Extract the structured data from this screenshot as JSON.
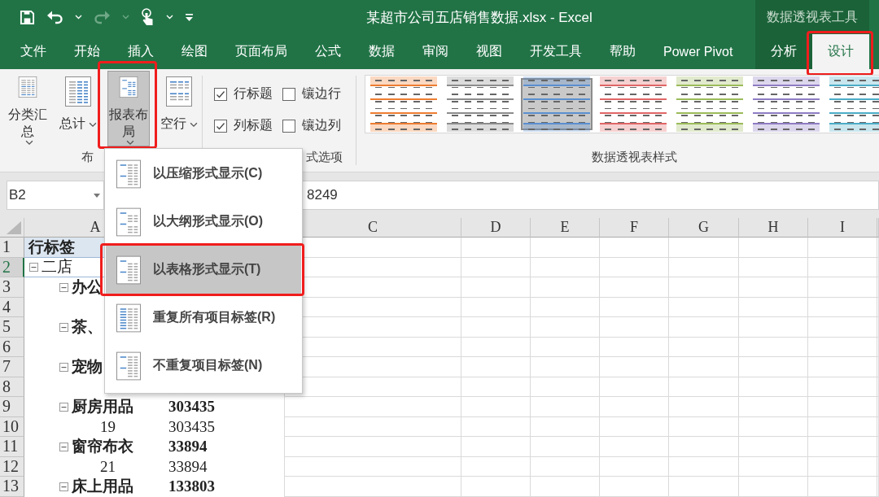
{
  "window": {
    "title": "某超市公司五店销售数据.xlsx  -  Excel",
    "context_label": "数据透视表工具"
  },
  "quick_access_toolbar": [
    {
      "kind": "save",
      "disabled": false
    },
    {
      "kind": "undo",
      "disabled": false
    },
    {
      "kind": "caret",
      "disabled": false
    },
    {
      "kind": "redo",
      "disabled": true
    },
    {
      "kind": "caret",
      "disabled": true
    },
    {
      "kind": "touch",
      "disabled": false
    },
    {
      "kind": "caret",
      "disabled": false
    },
    {
      "kind": "customize",
      "disabled": false
    }
  ],
  "tabs": [
    {
      "label": "文件",
      "selected": false,
      "contextual": false,
      "highlighted": false
    },
    {
      "label": "开始",
      "selected": false,
      "contextual": false,
      "highlighted": false
    },
    {
      "label": "插入",
      "selected": false,
      "contextual": false,
      "highlighted": false
    },
    {
      "label": "绘图",
      "selected": false,
      "contextual": false,
      "highlighted": false
    },
    {
      "label": "页面布局",
      "selected": false,
      "contextual": false,
      "highlighted": false
    },
    {
      "label": "公式",
      "selected": false,
      "contextual": false,
      "highlighted": false
    },
    {
      "label": "数据",
      "selected": false,
      "contextual": false,
      "highlighted": false
    },
    {
      "label": "审阅",
      "selected": false,
      "contextual": false,
      "highlighted": false
    },
    {
      "label": "视图",
      "selected": false,
      "contextual": false,
      "highlighted": false
    },
    {
      "label": "开发工具",
      "selected": false,
      "contextual": false,
      "highlighted": false
    },
    {
      "label": "帮助",
      "selected": false,
      "contextual": false,
      "highlighted": false
    },
    {
      "label": "Power Pivot",
      "selected": false,
      "contextual": false,
      "highlighted": false
    },
    {
      "label": "分析",
      "selected": false,
      "contextual": true,
      "highlighted": false
    },
    {
      "label": "设计",
      "selected": true,
      "contextual": true,
      "highlighted": true
    }
  ],
  "ribbon": {
    "layout_group": {
      "label": "布",
      "buttons": [
        {
          "label": "分类汇总",
          "kind": "subtotals",
          "pressed": false,
          "highlighted": false
        },
        {
          "label": "总计",
          "kind": "grand_totals",
          "pressed": false,
          "highlighted": false
        },
        {
          "label": "报表布局",
          "kind": "report_layout",
          "pressed": true,
          "highlighted": true
        },
        {
          "label": "空行",
          "kind": "blank_rows",
          "pressed": false,
          "highlighted": false
        }
      ]
    },
    "options_group": {
      "label": "式选项",
      "checkboxes": [
        {
          "label": "行标题",
          "checked": true
        },
        {
          "label": "镶边行",
          "checked": false
        },
        {
          "label": "列标题",
          "checked": true
        },
        {
          "label": "镶边列",
          "checked": false
        }
      ]
    },
    "styles_group": {
      "label": "数据透视表样式",
      "styles": [
        {
          "color": "#ed7d31",
          "selected": false
        },
        {
          "color": "#8c8c8c",
          "selected": false
        },
        {
          "color": "#5b8fd0",
          "selected": true
        },
        {
          "color": "#e06666",
          "selected": false
        },
        {
          "color": "#9bbb59",
          "selected": false
        },
        {
          "color": "#8e7cc3",
          "selected": false
        },
        {
          "color": "#4bacc6",
          "selected": false
        }
      ]
    }
  },
  "formula_bar": {
    "name_box": "B2",
    "formula": "8249"
  },
  "sheet": {
    "columns": [
      {
        "label": "A"
      },
      {
        "label": "C"
      },
      {
        "label": "D"
      },
      {
        "label": "E"
      },
      {
        "label": "F"
      },
      {
        "label": "G"
      },
      {
        "label": "H"
      },
      {
        "label": "I"
      }
    ],
    "rows": [
      {
        "number": "1",
        "selected": false,
        "kind": "header",
        "label": "行标签"
      },
      {
        "number": "2",
        "selected": true,
        "kind": "store",
        "label": "二店",
        "expanded": true
      },
      {
        "number": "3",
        "selected": false,
        "kind": "category",
        "label": "办公",
        "expanded": true
      },
      {
        "number": "4",
        "selected": false,
        "kind": "detail"
      },
      {
        "number": "5",
        "selected": false,
        "kind": "category",
        "label": "茶、",
        "expanded": true
      },
      {
        "number": "6",
        "selected": false,
        "kind": "detail"
      },
      {
        "number": "7",
        "selected": false,
        "kind": "category",
        "label": "宠物",
        "expanded": true
      },
      {
        "number": "8",
        "selected": false,
        "kind": "detail"
      },
      {
        "number": "9",
        "selected": false,
        "kind": "category",
        "label": "厨房用品",
        "expanded": true,
        "value": "303435"
      },
      {
        "number": "10",
        "selected": false,
        "kind": "detail",
        "label": "19",
        "value": "303435"
      },
      {
        "number": "11",
        "selected": false,
        "kind": "category",
        "label": "窗帘布衣",
        "expanded": true,
        "value": "33894"
      },
      {
        "number": "12",
        "selected": false,
        "kind": "detail",
        "label": "21",
        "value": "33894"
      },
      {
        "number": "13",
        "selected": false,
        "kind": "category",
        "label": "床上用品",
        "expanded": true,
        "value": "133803"
      }
    ]
  },
  "layout_menu": {
    "items": [
      {
        "label": "以压缩形式显示(C)",
        "kind": "compact",
        "selected": false,
        "highlighted": false
      },
      {
        "label": "以大纲形式显示(O)",
        "kind": "outline",
        "selected": false,
        "highlighted": false
      },
      {
        "label": "以表格形式显示(T)",
        "kind": "tabular",
        "selected": true,
        "highlighted": true
      },
      {
        "label": "重复所有项目标签(R)",
        "kind": "repeat",
        "selected": false,
        "highlighted": false
      },
      {
        "label": "不重复项目标签(N)",
        "kind": "norepeat",
        "selected": false,
        "highlighted": false
      }
    ]
  }
}
